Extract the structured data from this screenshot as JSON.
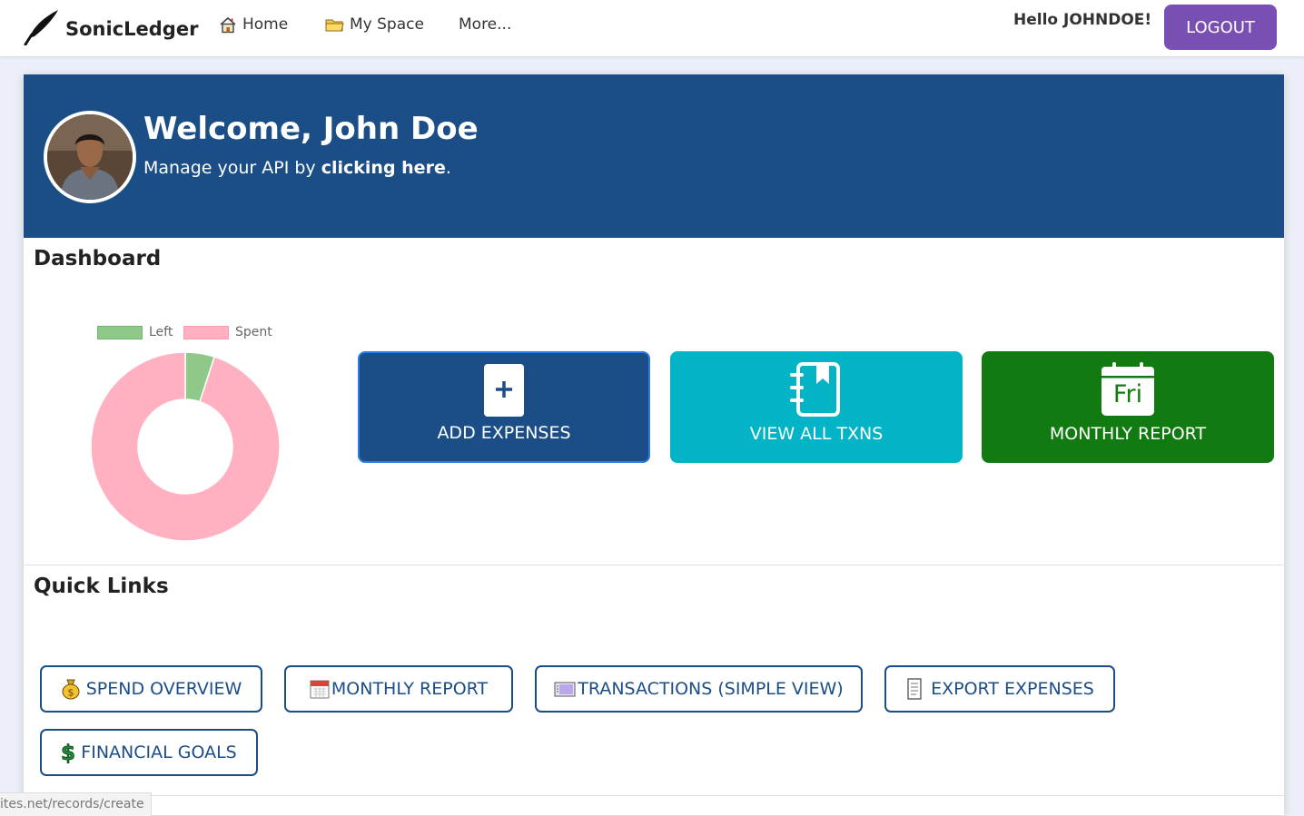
{
  "nav": {
    "brand": "SonicLedger",
    "links": [
      {
        "label": "Home",
        "icon": "house-icon"
      },
      {
        "label": "My Space",
        "icon": "folder-icon"
      },
      {
        "label": "More..."
      }
    ],
    "greeting": "Hello JOHNDOE!",
    "logout_label": "LOGOUT"
  },
  "banner": {
    "title": "Welcome, John Doe",
    "subtitle_prefix": "Manage your API by ",
    "subtitle_link": "clicking here",
    "subtitle_suffix": "."
  },
  "dashboard": {
    "title": "Dashboard",
    "tiles": [
      {
        "label": "ADD EXPENSES",
        "icon": "plus-icon",
        "color": "#1b4e86"
      },
      {
        "label": "VIEW ALL TXNS",
        "icon": "notebook-icon",
        "color": "#02b4c5"
      },
      {
        "label": "MONTHLY REPORT",
        "icon": "calendar-icon",
        "icon_text": "Fri",
        "color": "#117b12"
      }
    ]
  },
  "chart_data": {
    "type": "pie",
    "donut": true,
    "labels": [
      "Left",
      "Spent"
    ],
    "values": [
      5,
      95
    ],
    "colors": [
      "#8ec98a",
      "#ffb1c1"
    ],
    "legend": "top"
  },
  "quick_links": {
    "title": "Quick Links",
    "items": [
      {
        "label": "SPEND OVERVIEW",
        "icon": "money-bag-icon"
      },
      {
        "label": "MONTHLY REPORT",
        "icon": "calendar-icon"
      },
      {
        "label": "TRANSACTIONS (SIMPLE VIEW)",
        "icon": "card-index-icon"
      },
      {
        "label": "EXPORT EXPENSES",
        "icon": "page-icon"
      },
      {
        "label": "FINANCIAL GOALS",
        "icon": "dollar-sign-icon"
      }
    ]
  },
  "status_bar": {
    "url": "ites.net/records/create"
  },
  "colors": {
    "primary": "#1b4e86",
    "accent": "#7a4fb4",
    "teal": "#02b4c5",
    "green": "#117b12"
  }
}
